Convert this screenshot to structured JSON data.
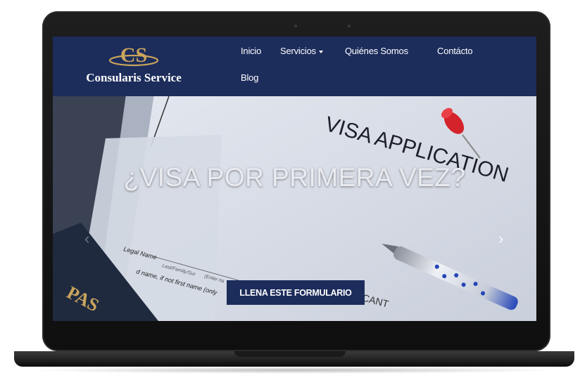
{
  "brand": {
    "name": "Consularis Service",
    "initials": "CS"
  },
  "nav": {
    "items": [
      {
        "label": "Inicio"
      },
      {
        "label": "Servicios"
      },
      {
        "label": "Quiénes Somos"
      },
      {
        "label": "Contácto"
      },
      {
        "label": "Blog"
      }
    ]
  },
  "hero": {
    "title": "¿VISA POR PRIMERA VEZ?",
    "cta_label": "LLENA ESTE FORMULARIO",
    "document_heading_1": "VISA APPLICATION",
    "form_label_1": "Legal Name",
    "form_label_2": "Last/Family/Sur",
    "form_label_3": "(Enter na",
    "form_label_4": "d name, if not first name (only",
    "form_label_5": "ICANT",
    "passport_text": "PAS"
  },
  "colors": {
    "navbar": "#1c2c5b",
    "logo_gold": "#c9a45c",
    "cta": "#1c2c5b",
    "text": "#ffffff"
  },
  "icons": {
    "prev": "chevron-left-icon",
    "next": "chevron-right-icon",
    "dropdown": "caret-down-icon"
  }
}
